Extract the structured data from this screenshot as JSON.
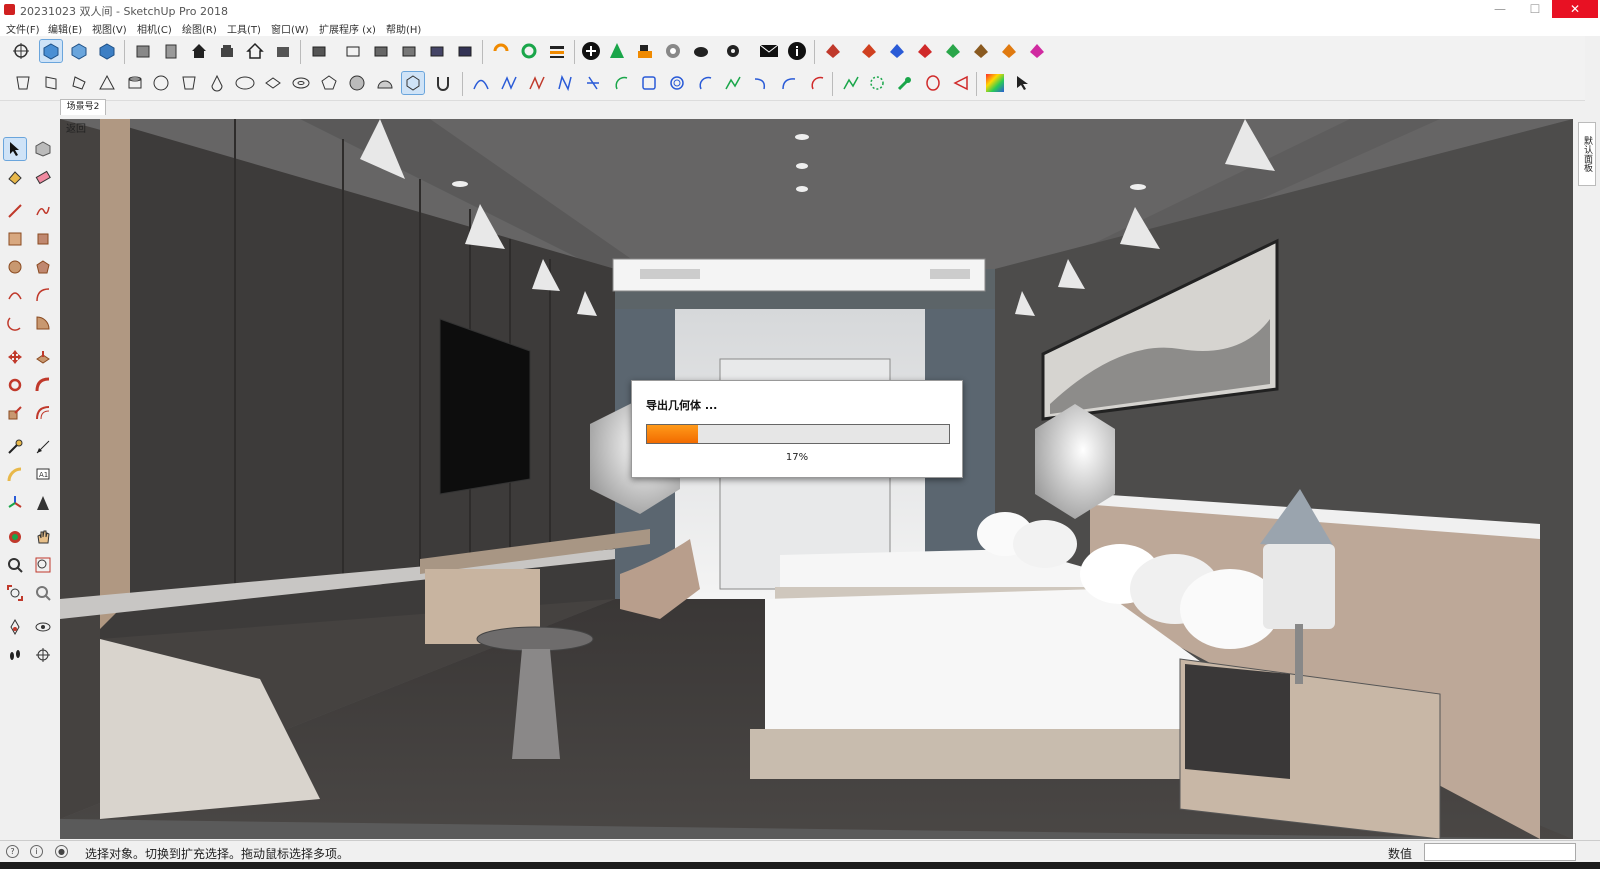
{
  "window": {
    "title": "20231023 双人间 - SketchUp Pro 2018",
    "minimize": "—",
    "maximize": "☐",
    "close": "✕"
  },
  "menu": {
    "items": [
      {
        "label": "文件(F)"
      },
      {
        "label": "编辑(E)"
      },
      {
        "label": "视图(V)"
      },
      {
        "label": "相机(C)"
      },
      {
        "label": "绘图(R)"
      },
      {
        "label": "工具(T)"
      },
      {
        "label": "窗口(W)"
      },
      {
        "label": "扩展程序 (x)"
      },
      {
        "label": "帮助(H)"
      }
    ]
  },
  "scene_tab": {
    "label": "场景号2"
  },
  "viewport": {
    "back_label": "返回"
  },
  "right_tray": {
    "label": "默认面板"
  },
  "dialog": {
    "message": "导出几何体 ...",
    "progress_fraction": 0.17,
    "progress_text": "17%"
  },
  "statusbar": {
    "hint": "选择对象。切换到扩充选择。拖动鼠标选择多项。",
    "measure_label": "数值",
    "measure_value": ""
  },
  "colors": {
    "progress_fill": "#f27a00",
    "selection_highlight": "#cfe3f7",
    "close_button": "#e81123"
  }
}
